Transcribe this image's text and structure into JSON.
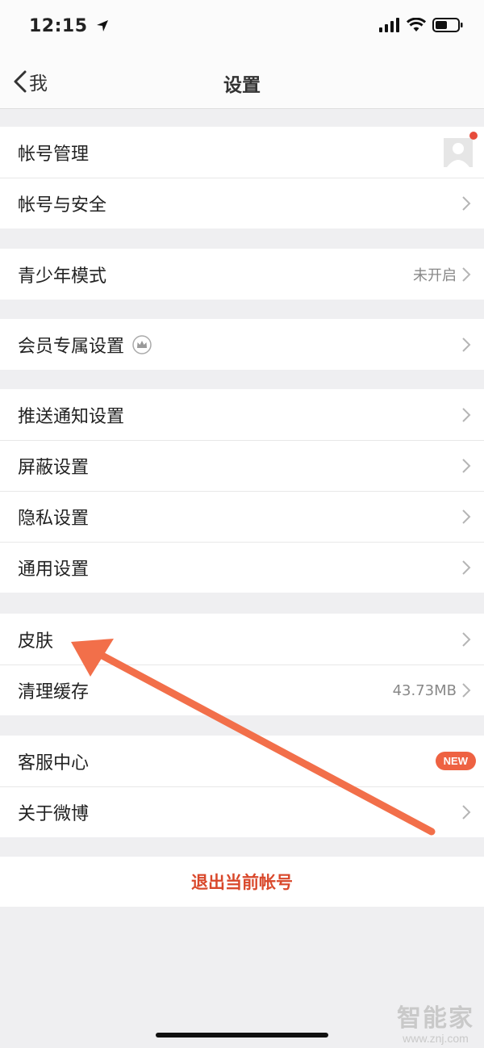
{
  "status": {
    "time": "12:15"
  },
  "nav": {
    "back_label": "我",
    "title": "设置"
  },
  "groups": {
    "account": [
      {
        "label": "帐号管理"
      },
      {
        "label": "帐号与安全"
      }
    ],
    "youth": [
      {
        "label": "青少年模式",
        "value": "未开启"
      }
    ],
    "member": [
      {
        "label": "会员专属设置"
      }
    ],
    "settings": [
      {
        "label": "推送通知设置"
      },
      {
        "label": "屏蔽设置"
      },
      {
        "label": "隐私设置"
      },
      {
        "label": "通用设置"
      }
    ],
    "appearance": [
      {
        "label": "皮肤"
      },
      {
        "label": "清理缓存",
        "value": "43.73MB"
      }
    ],
    "support": [
      {
        "label": "客服中心",
        "badge": "NEW"
      },
      {
        "label": "关于微博"
      }
    ]
  },
  "logout_label": "退出当前帐号",
  "watermark": {
    "title": "智能家",
    "url": "www.znj.com"
  },
  "colors": {
    "accent": "#d9482b",
    "badge": "#ee6242",
    "annotation_arrow": "#f26f4a"
  }
}
